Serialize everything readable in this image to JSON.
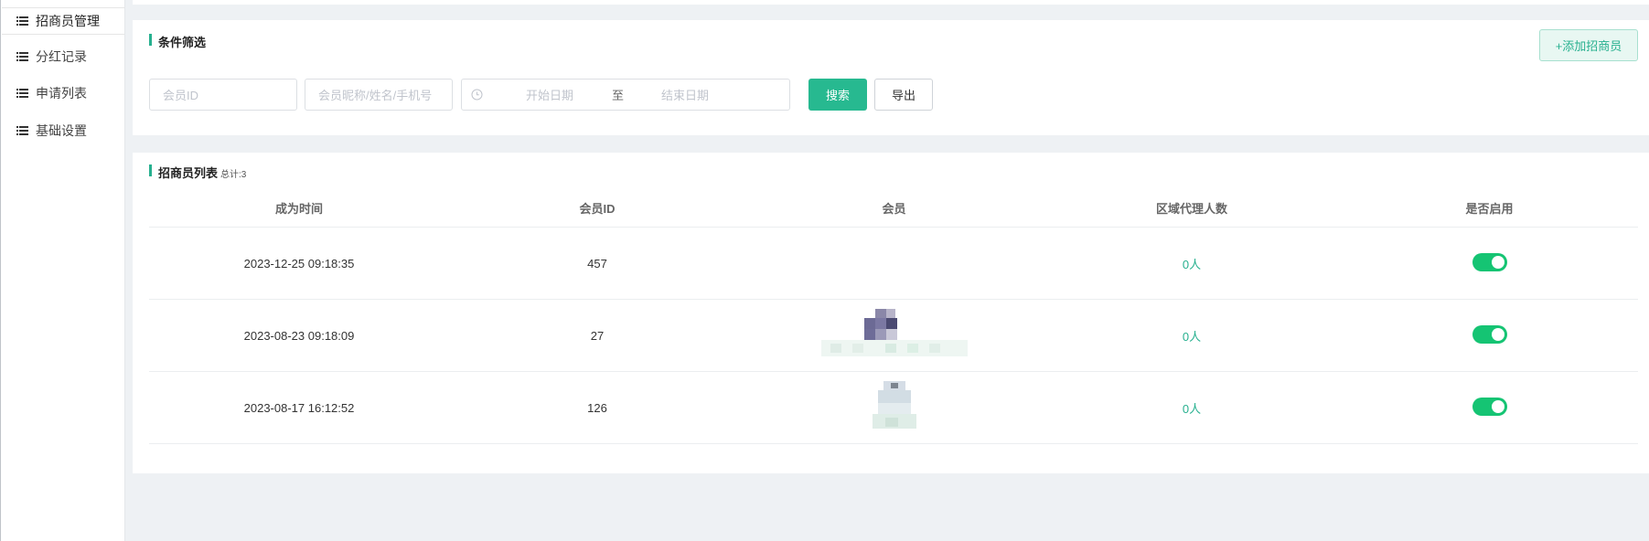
{
  "sidebar": {
    "items": [
      {
        "label": "招商员管理",
        "icon": "list-icon"
      },
      {
        "label": "分红记录",
        "icon": "list-icon"
      },
      {
        "label": "申请列表",
        "icon": "list-icon"
      },
      {
        "label": "基础设置",
        "icon": "list-icon"
      }
    ],
    "active_index": 0
  },
  "filter": {
    "title": "条件筛选",
    "add_button": "+添加招商员",
    "member_id_placeholder": "会员ID",
    "member_name_placeholder": "会员昵称/姓名/手机号",
    "date_start_placeholder": "开始日期",
    "date_separator": "至",
    "date_end_placeholder": "结束日期",
    "search_button": "搜索",
    "export_button": "导出"
  },
  "list": {
    "title": "招商员列表",
    "total_label": "总计:3",
    "columns": [
      "成为时间",
      "会员ID",
      "会员",
      "区域代理人数",
      "是否启用"
    ],
    "rows": [
      {
        "time": "2023-12-25 09:18:35",
        "member_id": "457",
        "agent_count": "0人",
        "enabled": true
      },
      {
        "time": "2023-08-23 09:18:09",
        "member_id": "27",
        "agent_count": "0人",
        "enabled": true
      },
      {
        "time": "2023-08-17 16:12:52",
        "member_id": "126",
        "agent_count": "0人",
        "enabled": true
      }
    ]
  },
  "colors": {
    "accent": "#27b08f",
    "search_button": "#27b990",
    "toggle_on": "#15c473"
  }
}
